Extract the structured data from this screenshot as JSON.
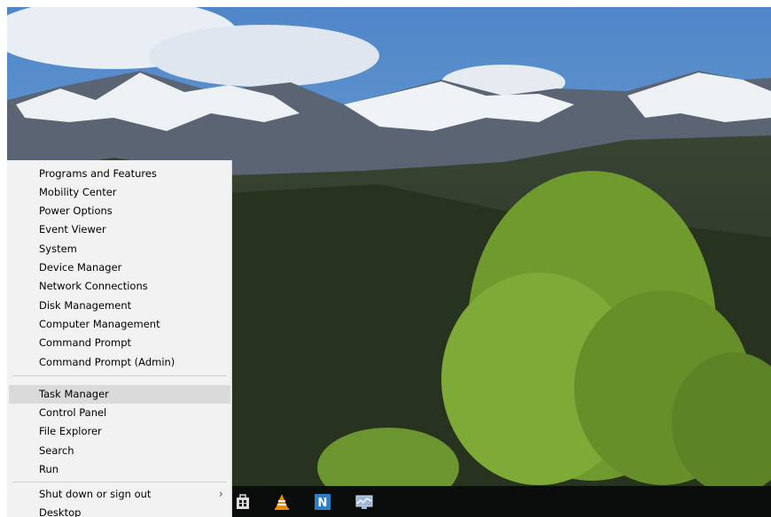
{
  "menu": {
    "items": [
      {
        "label": "Programs and Features"
      },
      {
        "label": "Mobility Center"
      },
      {
        "label": "Power Options"
      },
      {
        "label": "Event Viewer"
      },
      {
        "label": "System"
      },
      {
        "label": "Device Manager"
      },
      {
        "label": "Network Connections"
      },
      {
        "label": "Disk Management"
      },
      {
        "label": "Computer Management"
      },
      {
        "label": "Command Prompt"
      },
      {
        "label": "Command Prompt (Admin)"
      },
      {
        "label": "Task Manager",
        "selected": true
      },
      {
        "label": "Control Panel"
      },
      {
        "label": "File Explorer"
      },
      {
        "label": "Search"
      },
      {
        "label": "Run"
      },
      {
        "label": "Shut down or sign out",
        "has_submenu": true
      },
      {
        "label": "Desktop"
      }
    ],
    "submenu_icon": "chevron-right-icon"
  },
  "taskbar": {
    "icons": [
      "store-icon",
      "vlc-icon",
      "n-app-icon",
      "network-monitor-icon"
    ]
  },
  "colors": {
    "menu_bg": "#f2f2f2",
    "selected_bg": "#dadada",
    "taskbar_bg": "#0b0c0c",
    "n_app": "#2a7fc9",
    "vlc_orange": "#f08a00"
  }
}
